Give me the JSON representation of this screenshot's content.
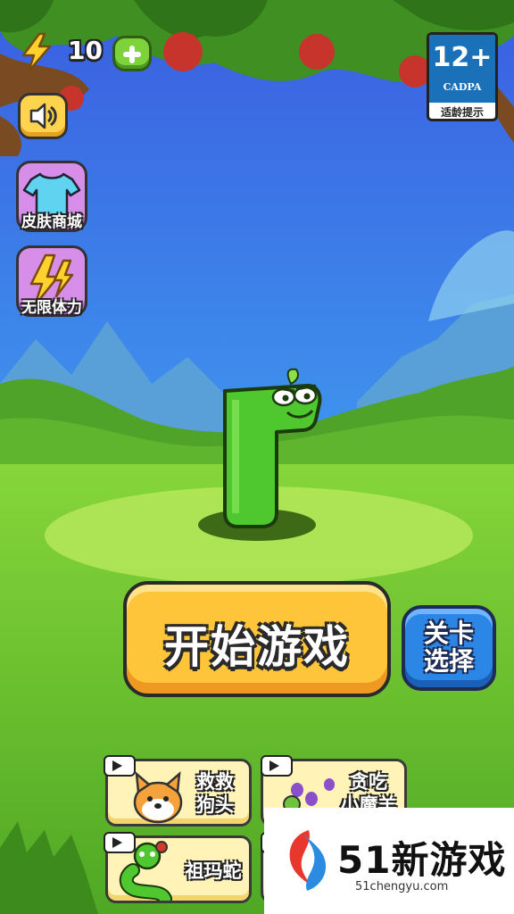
{
  "hud": {
    "energy_count": "10",
    "sound": "speaker-icon"
  },
  "age_rating": {
    "number": "12+",
    "org": "CADPA",
    "tip": "适龄提示"
  },
  "side_menu": {
    "skin_shop_label": "皮肤商城",
    "unlimited_energy_label": "无限体力"
  },
  "main": {
    "start_label": "开始游戏",
    "level_select_line1": "关卡",
    "level_select_line2": "选择"
  },
  "promo_cards": [
    {
      "line1": "救救",
      "line2": "狗头"
    },
    {
      "line1": "贪吃",
      "line2": "小魔羊"
    },
    {
      "line1": "祖玛蛇"
    },
    {}
  ],
  "watermark": {
    "brand": "51新游戏",
    "url": "51chengyu.com"
  },
  "colors": {
    "sky_top": "#3a5ee0",
    "sky_bottom": "#5cc8f0",
    "grass": "#7ccf33",
    "snake": "#4fc830",
    "start_button": "#ffc53a",
    "level_button": "#2c86e6"
  }
}
